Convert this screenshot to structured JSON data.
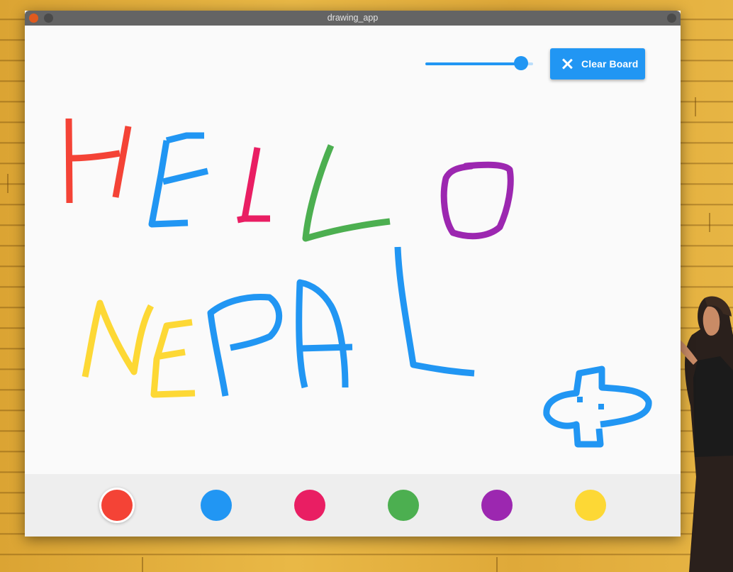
{
  "window": {
    "title": "drawing_app",
    "buttons": {
      "close_color": "#e05a1e",
      "minimize_color": "#4a4a4a",
      "maximize_color": "#4a4a4a"
    }
  },
  "toolbar": {
    "stroke_slider": {
      "value_fraction": 0.89,
      "color": "#2196f3"
    },
    "clear_button": {
      "label": "Clear Board",
      "icon": "close-icon",
      "color": "#2196f3"
    }
  },
  "canvas": {
    "drawn_words": [
      "HELLO",
      "NEPAL"
    ],
    "stroke_colors": {
      "red": "#f44336",
      "blue": "#2196f3",
      "pink": "#e91e63",
      "green": "#4caf50",
      "purple": "#9c27b0",
      "yellow": "#fdd835"
    }
  },
  "palette": {
    "selected_index": 0,
    "colors": [
      "#f44336",
      "#2196f3",
      "#e91e63",
      "#4caf50",
      "#9c27b0",
      "#fdd835"
    ]
  }
}
